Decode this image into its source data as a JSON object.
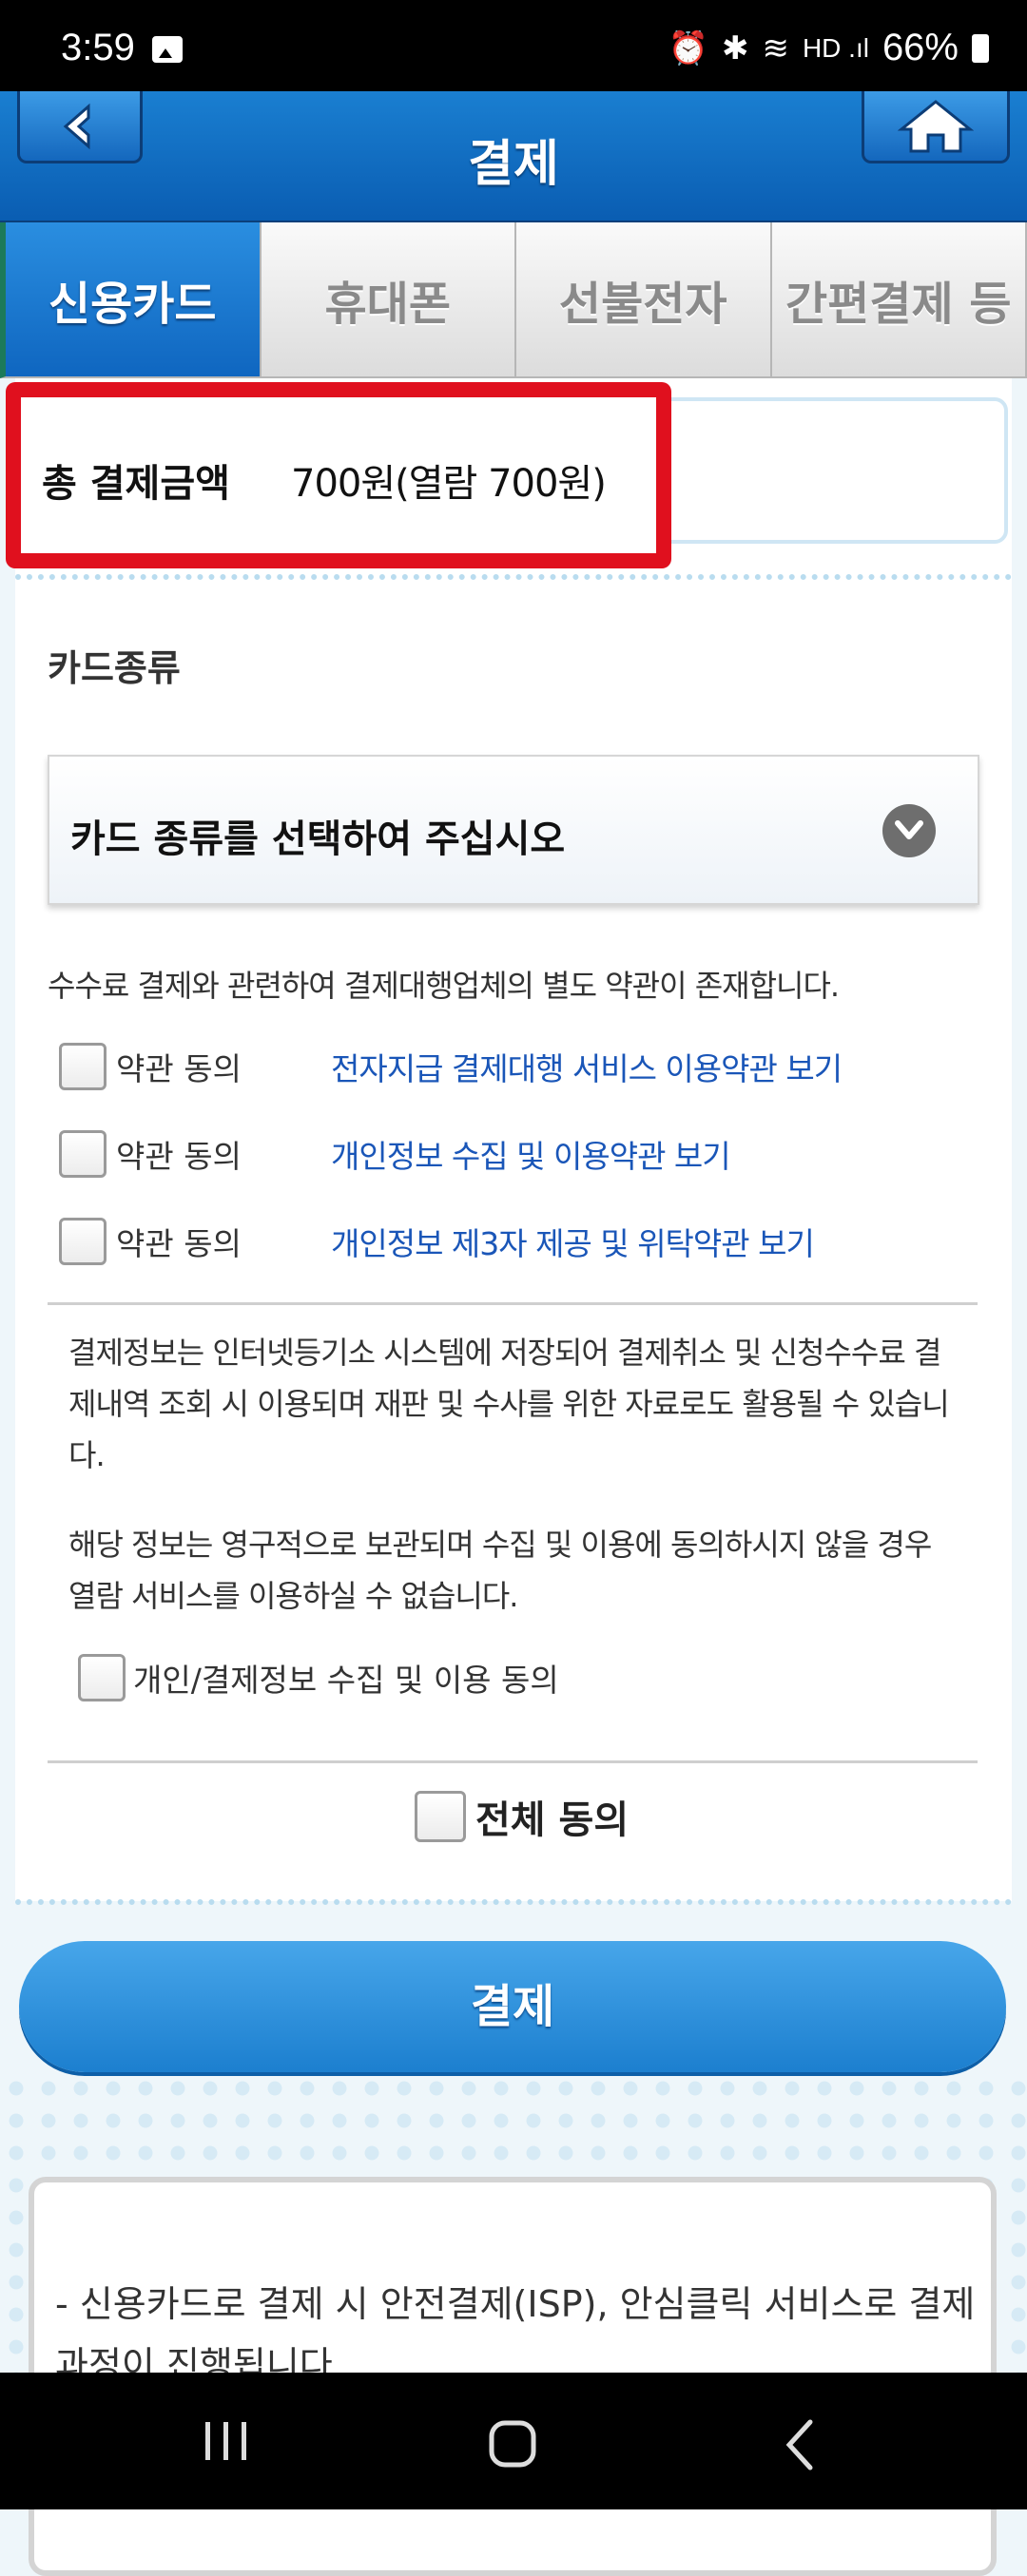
{
  "status_bar": {
    "time": "3:59",
    "battery": "66%",
    "icons": [
      "image-icon",
      "alarm-icon",
      "bluetooth-icon",
      "wifi-icon",
      "hd-voice-icon",
      "signal-icon",
      "battery-icon"
    ]
  },
  "header": {
    "title": "결제",
    "back_icon": "arrow-left-icon",
    "home_icon": "home-icon"
  },
  "tabs": [
    {
      "label": "신용카드",
      "active": true
    },
    {
      "label": "휴대폰",
      "active": false
    },
    {
      "label": "선불전자",
      "active": false
    },
    {
      "label": "간편결제 등",
      "active": false
    }
  ],
  "amount": {
    "label": "총 결제금액",
    "value": "700원(열람 700원)"
  },
  "card_type": {
    "title": "카드종류",
    "placeholder": "카드 종류를 선택하여 주십시오"
  },
  "notice": "수수료 결제와 관련하여 결제대행업체의 별도 약관이 존재합니다.",
  "agreements": [
    {
      "label": "약관 동의",
      "link": "전자지급 결제대행 서비스 이용약관 보기"
    },
    {
      "label": "약관 동의",
      "link": "개인정보 수집 및 이용약관 보기"
    },
    {
      "label": "약관 동의",
      "link": "개인정보 제3자 제공 및 위탁약관 보기"
    }
  ],
  "info": {
    "para1": "결제정보는 인터넷등기소 시스템에 저장되어 결제취소 및 신청수수료 결제내역 조회 시 이용되며 재판 및 수사를 위한 자료로도 활용될 수 있습니다.",
    "para2": "해당 정보는 영구적으로 보관되며 수집 및 이용에 동의하시지 않을 경우 열람 서비스를 이용하실 수 없습니다.",
    "consent_label": "개인/결제정보 수집 및 이용 동의"
  },
  "all_agree_label": "전체 동의",
  "pay_button_label": "결제",
  "footer_note": "- 신용카드로 결제 시 안전결제(ISP), 안심클릭 서비스로 결제과정이 진행됩니다.",
  "colors": {
    "primary_blue": "#0f66c0",
    "highlight_red": "#e0101e",
    "link_blue": "#1a56b8"
  }
}
